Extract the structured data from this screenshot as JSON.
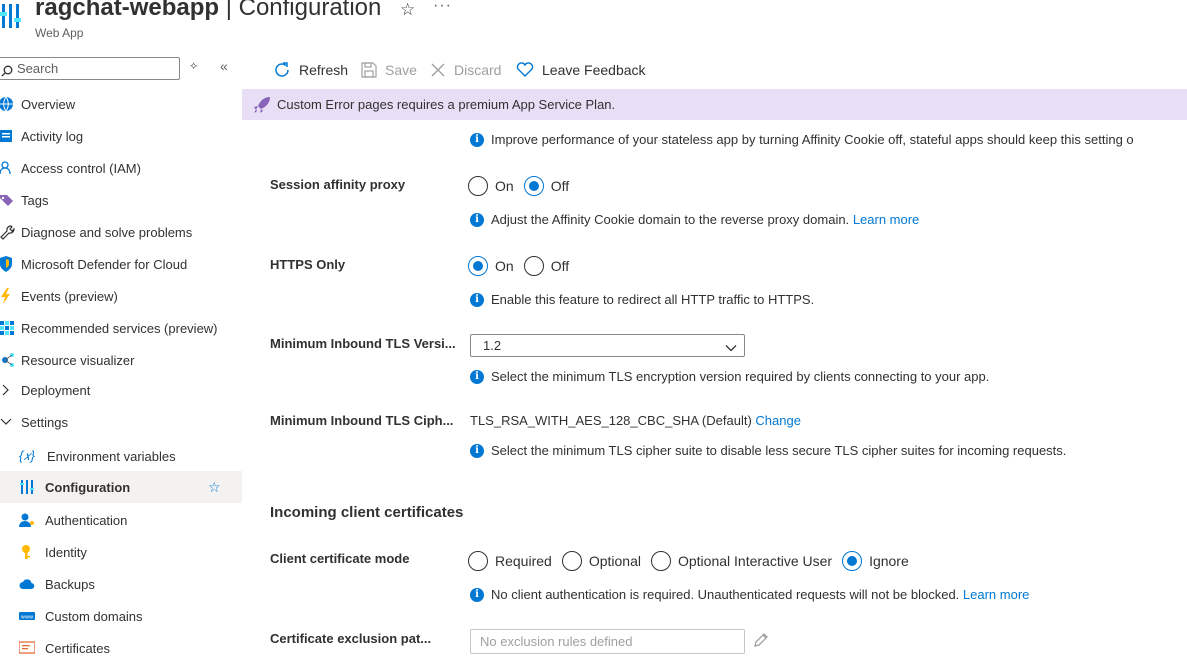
{
  "header": {
    "resource_name": "ragchat-webapp",
    "separator": " | ",
    "page_title": "Configuration",
    "resource_type": "Web App",
    "favorite_glyph": "☆",
    "more_glyph": "···"
  },
  "sidebar": {
    "search_placeholder": "Search",
    "items": [
      {
        "label": "Overview",
        "icon": "globe-icon"
      },
      {
        "label": "Activity log",
        "icon": "log-icon"
      },
      {
        "label": "Access control (IAM)",
        "icon": "people-icon"
      },
      {
        "label": "Tags",
        "icon": "tag-icon"
      },
      {
        "label": "Diagnose and solve problems",
        "icon": "wrench-icon"
      },
      {
        "label": "Microsoft Defender for Cloud",
        "icon": "shield-icon"
      },
      {
        "label": "Events (preview)",
        "icon": "lightning-icon"
      },
      {
        "label": "Recommended services (preview)",
        "icon": "grid-icon"
      },
      {
        "label": "Resource visualizer",
        "icon": "network-icon"
      },
      {
        "label": "Deployment",
        "icon": "chevron-right-icon"
      },
      {
        "label": "Settings",
        "icon": "chevron-down-icon"
      },
      {
        "label": "Environment variables",
        "icon": "variable-icon"
      },
      {
        "label": "Configuration",
        "icon": "sliders-icon"
      },
      {
        "label": "Authentication",
        "icon": "person-key-icon"
      },
      {
        "label": "Identity",
        "icon": "key-icon"
      },
      {
        "label": "Backups",
        "icon": "cloud-icon"
      },
      {
        "label": "Custom domains",
        "icon": "www-icon"
      },
      {
        "label": "Certificates",
        "icon": "certificate-icon"
      }
    ],
    "active_item": "Configuration"
  },
  "toolbar": {
    "refresh": "Refresh",
    "save": "Save",
    "discard": "Discard",
    "feedback": "Leave Feedback"
  },
  "banner": {
    "text": "Custom Error pages requires a premium App Service Plan."
  },
  "settings": {
    "affinity_info": "Improve performance of your stateless app by turning Affinity Cookie off, stateful apps should keep this setting o",
    "session_affinity_proxy": {
      "label": "Session affinity proxy",
      "options": [
        "On",
        "Off"
      ],
      "selected": "Off",
      "info": "Adjust the Affinity Cookie domain to the reverse proxy domain.",
      "link": "Learn more"
    },
    "https_only": {
      "label": "HTTPS Only",
      "options": [
        "On",
        "Off"
      ],
      "selected": "On",
      "info": "Enable this feature to redirect all HTTP traffic to HTTPS."
    },
    "min_tls_version": {
      "label": "Minimum Inbound TLS Versi...",
      "value": "1.2",
      "info": "Select the minimum TLS encryption version required by clients connecting to your app."
    },
    "min_tls_cipher": {
      "label": "Minimum Inbound TLS Ciph...",
      "value": "TLS_RSA_WITH_AES_128_CBC_SHA (Default)",
      "link": "Change",
      "info": "Select the minimum TLS cipher suite to disable less secure TLS cipher suites for incoming requests."
    },
    "incoming_certs_heading": "Incoming client certificates",
    "client_cert_mode": {
      "label": "Client certificate mode",
      "options": [
        "Required",
        "Optional",
        "Optional Interactive User",
        "Ignore"
      ],
      "selected": "Ignore",
      "info": "No client authentication is required. Unauthenticated requests will not be blocked.",
      "link": "Learn more"
    },
    "cert_exclusion": {
      "label": "Certificate exclusion pat...",
      "placeholder": "No exclusion rules defined"
    }
  },
  "colors": {
    "accent": "#0078d4",
    "banner_bg": "#e8dff7",
    "active_nav_bg": "#f3f2f1"
  }
}
